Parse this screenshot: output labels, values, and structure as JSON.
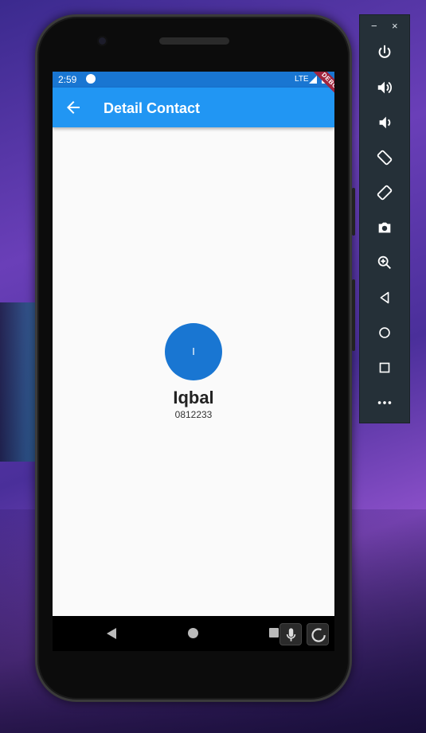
{
  "status_bar": {
    "time": "2:59",
    "network": "LTE"
  },
  "app_bar": {
    "title": "Detail Contact"
  },
  "debug_banner": "DEBUG",
  "contact": {
    "initial": "I",
    "name": "Iqbal",
    "phone": "0812233"
  },
  "toolbar": {
    "minimize": "−",
    "close": "×",
    "buttons": [
      "power-icon",
      "volume-up-icon",
      "volume-down-icon",
      "rotate-left-icon",
      "rotate-right-icon",
      "camera-icon",
      "zoom-icon",
      "back-icon",
      "home-icon",
      "overview-icon",
      "more-icon"
    ]
  },
  "colors": {
    "app_bar": "#2196f3",
    "status_bar": "#1976d2",
    "avatar": "#1976d2",
    "debug": "#a0253e",
    "toolbar": "#253038"
  }
}
